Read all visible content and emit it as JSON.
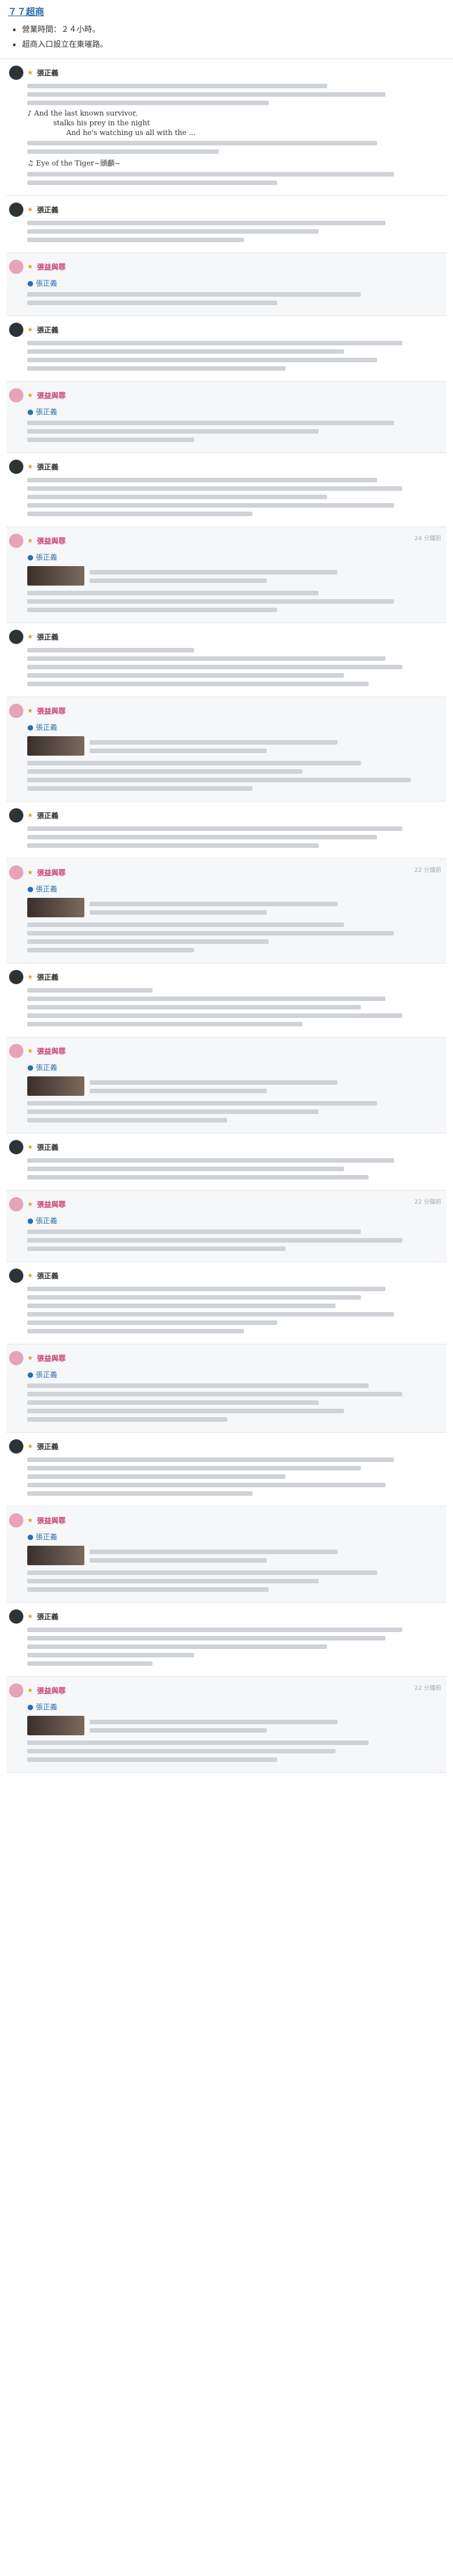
{
  "header": {
    "title": "７７超商",
    "bullets": [
      "營業時間：２４小時。",
      "超商入口設立在東璀路。"
    ]
  },
  "poem": {
    "l1": "♪ And the last known survivor,",
    "l2": "stalks his prey in the night",
    "l3": "And he's watching us all with the ...",
    "l4": "♫ Eye of the Tiger~頭顱~"
  },
  "users": {
    "a": "張正義",
    "b": "張益與罪",
    "mention": "● 張正義"
  },
  "times": {
    "t1": "24 分鐘前",
    "t2": "22 分鐘前",
    "t3": "22 分鐘前",
    "t4": "22 分鐘前"
  }
}
